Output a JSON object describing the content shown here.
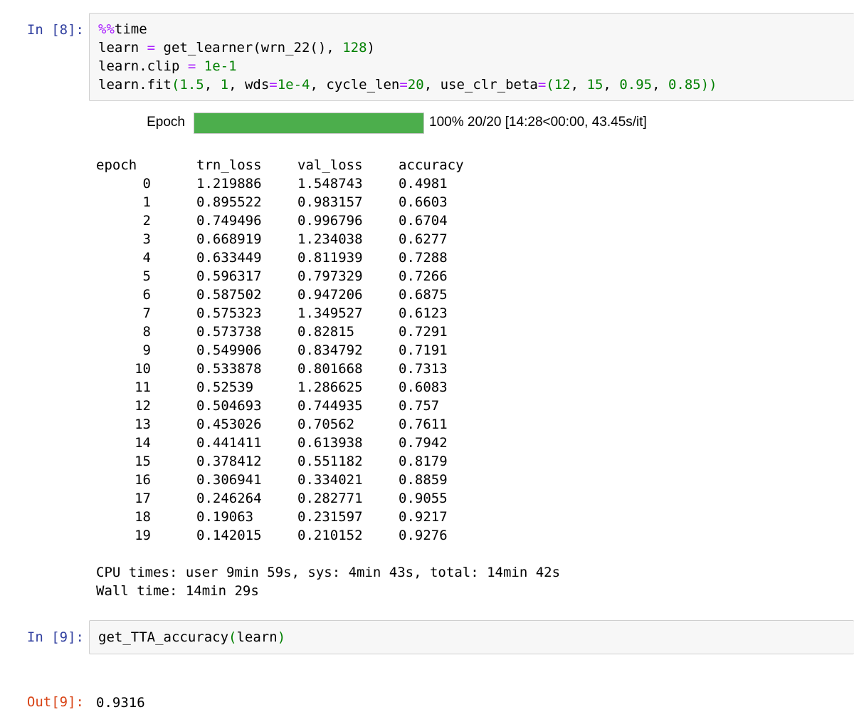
{
  "cell8": {
    "prompt": "In [8]:",
    "code": {
      "l1_magic": "%%",
      "l1_rest": "time",
      "l2_a": "learn ",
      "l2_eq": "=",
      "l2_b": " get_learner(wrn_22(), ",
      "l2_num": "128",
      "l2_c": ")",
      "l3_a": "learn.clip ",
      "l3_eq": "=",
      "l3_sp": " ",
      "l3_num": "1e-1",
      "l4_a": "learn.fit",
      "l4_p1": "(",
      "l4_n1": "1.5",
      "l4_b": ", ",
      "l4_n2": "1",
      "l4_c": ", wds",
      "l4_eq1": "=",
      "l4_n3": "1e-4",
      "l4_d": ", cycle_len",
      "l4_eq2": "=",
      "l4_n4": "20",
      "l4_e": ", use_clr_beta",
      "l4_eq3": "=",
      "l4_p2": "(",
      "l4_n5": "12",
      "l4_f": ", ",
      "l4_n6": "15",
      "l4_g": ", ",
      "l4_n7": "0.95",
      "l4_h": ", ",
      "l4_n8": "0.85",
      "l4_p3": "))"
    },
    "progress": {
      "label": "Epoch",
      "fraction": 1.0,
      "text": "100% 20/20 [14:28<00:00, 43.45s/it]",
      "color": "#4cae4c"
    },
    "table": {
      "headers": [
        "epoch",
        "trn_loss",
        "val_loss",
        "accuracy"
      ],
      "rows": [
        [
          "0",
          "1.219886",
          "1.548743",
          "0.4981"
        ],
        [
          "1",
          "0.895522",
          "0.983157",
          "0.6603"
        ],
        [
          "2",
          "0.749496",
          "0.996796",
          "0.6704"
        ],
        [
          "3",
          "0.668919",
          "1.234038",
          "0.6277"
        ],
        [
          "4",
          "0.633449",
          "0.811939",
          "0.7288"
        ],
        [
          "5",
          "0.596317",
          "0.797329",
          "0.7266"
        ],
        [
          "6",
          "0.587502",
          "0.947206",
          "0.6875"
        ],
        [
          "7",
          "0.575323",
          "1.349527",
          "0.6123"
        ],
        [
          "8",
          "0.573738",
          "0.82815",
          "0.7291"
        ],
        [
          "9",
          "0.549906",
          "0.834792",
          "0.7191"
        ],
        [
          "10",
          "0.533878",
          "0.801668",
          "0.7313"
        ],
        [
          "11",
          "0.52539",
          "1.286625",
          "0.6083"
        ],
        [
          "12",
          "0.504693",
          "0.744935",
          "0.757"
        ],
        [
          "13",
          "0.453026",
          "0.70562",
          "0.7611"
        ],
        [
          "14",
          "0.441411",
          "0.613938",
          "0.7942"
        ],
        [
          "15",
          "0.378412",
          "0.551182",
          "0.8179"
        ],
        [
          "16",
          "0.306941",
          "0.334021",
          "0.8859"
        ],
        [
          "17",
          "0.246264",
          "0.282771",
          "0.9055"
        ],
        [
          "18",
          "0.19063",
          "0.231597",
          "0.9217"
        ],
        [
          "19",
          "0.142015",
          "0.210152",
          "0.9276"
        ]
      ]
    },
    "stdout": [
      "CPU times: user 9min 59s, sys: 4min 43s, total: 14min 42s",
      "Wall time: 14min 29s"
    ]
  },
  "cell9": {
    "prompt": "In [9]:",
    "code": {
      "fn": "get_TTA_accuracy",
      "p1": "(",
      "arg": "learn",
      "p2": ")"
    },
    "out_prompt": "Out[9]:",
    "out_value": "0.9316"
  }
}
